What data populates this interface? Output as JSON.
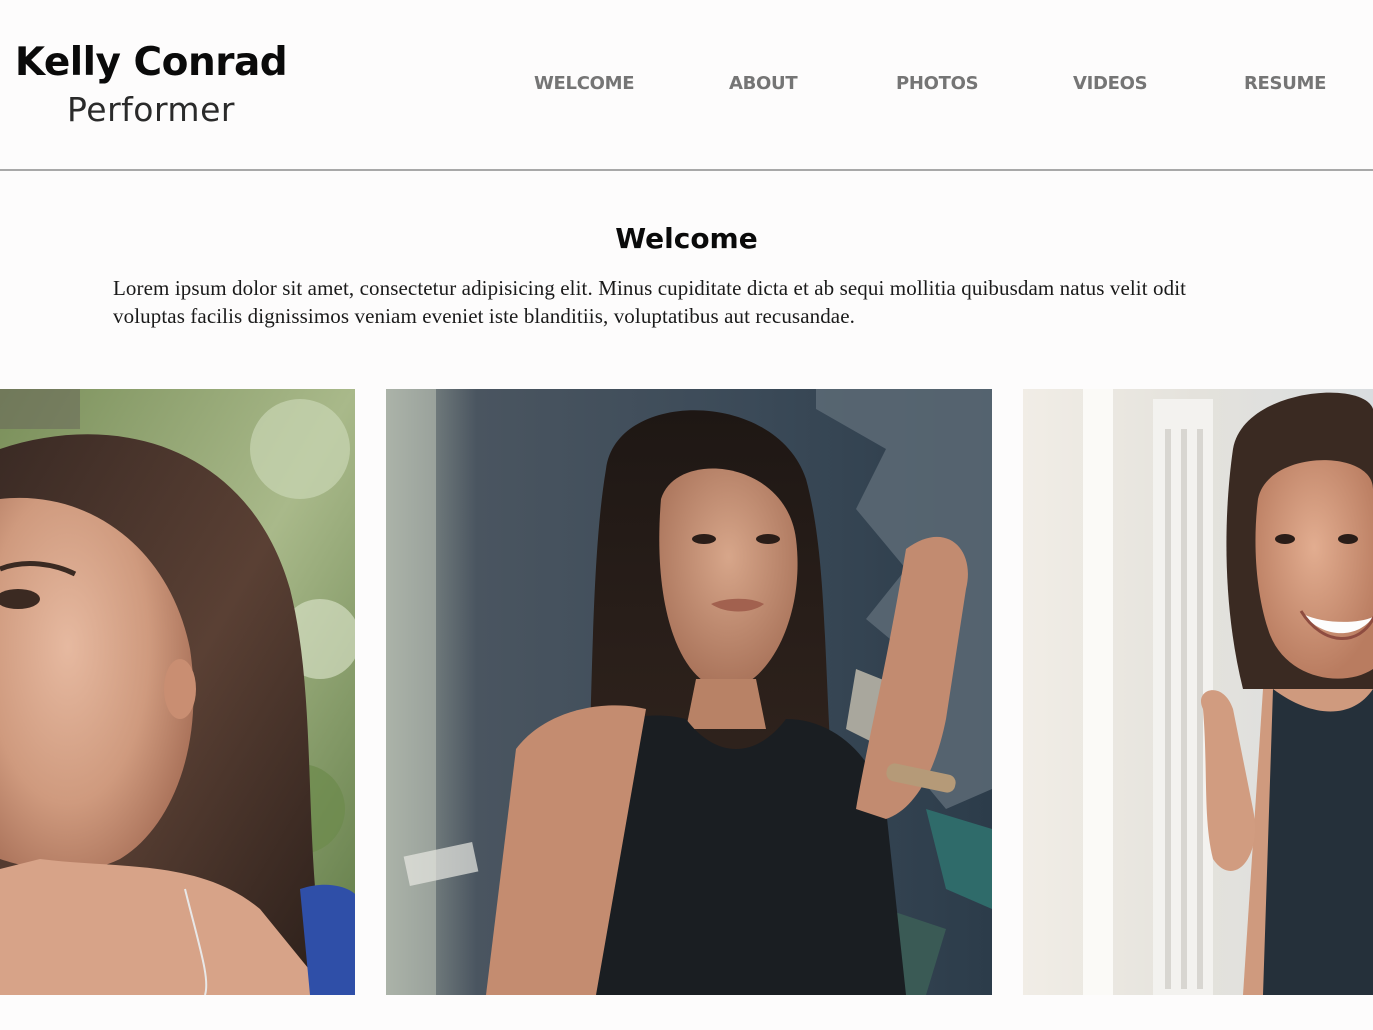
{
  "header": {
    "brand_name": "Kelly Conrad",
    "tagline": "Performer",
    "nav": [
      {
        "label": "WELCOME"
      },
      {
        "label": "ABOUT"
      },
      {
        "label": "PHOTOS"
      },
      {
        "label": "VIDEOS"
      },
      {
        "label": "RESUME"
      }
    ]
  },
  "welcome": {
    "title": "Welcome",
    "body": "Lorem ipsum dolor sit amet, consectetur adipisicing elit. Minus cupiditate dicta et ab sequi mollitia quibusdam natus velit odit voluptas facilis dignissimos veniam eveniet iste blanditiis, voluptatibus aut recusandae."
  },
  "colors": {
    "background": "#fdfcfc",
    "nav_text": "#757575",
    "divider": "#a8a8a8",
    "heading": "#0a0a0a"
  }
}
